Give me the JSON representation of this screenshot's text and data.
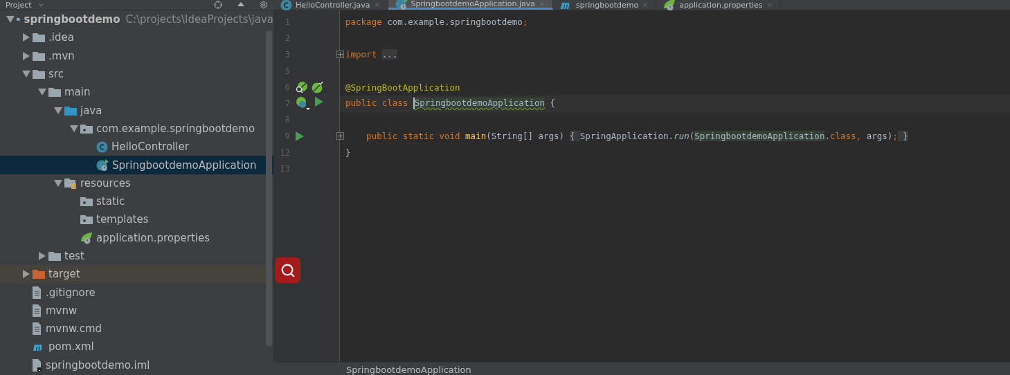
{
  "project_panel": {
    "title": "Project",
    "tree": [
      {
        "label": "springbootdemo",
        "path": "C:\\projects\\IdeaProjects\\java",
        "kind": "module",
        "expanded": true,
        "selected": false,
        "children": [
          {
            "label": ".idea",
            "kind": "folder",
            "expanded": false,
            "selected": false
          },
          {
            "label": ".mvn",
            "kind": "folder",
            "expanded": false,
            "selected": false
          },
          {
            "label": "src",
            "kind": "folder",
            "expanded": true,
            "selected": false,
            "children": [
              {
                "label": "main",
                "kind": "folder",
                "expanded": true,
                "selected": false,
                "children": [
                  {
                    "label": "java",
                    "kind": "source-folder",
                    "expanded": true,
                    "selected": false,
                    "children": [
                      {
                        "label": "com.example.springbootdemo",
                        "kind": "package",
                        "expanded": true,
                        "selected": false,
                        "children": [
                          {
                            "label": "HelloController",
                            "kind": "class",
                            "selected": false
                          },
                          {
                            "label": "SpringbootdemoApplication",
                            "kind": "spring-class",
                            "selected": true
                          }
                        ]
                      }
                    ]
                  },
                  {
                    "label": "resources",
                    "kind": "resources",
                    "expanded": true,
                    "selected": false,
                    "children": [
                      {
                        "label": "static",
                        "kind": "package",
                        "selected": false
                      },
                      {
                        "label": "templates",
                        "kind": "package",
                        "selected": false
                      },
                      {
                        "label": "application.properties",
                        "kind": "spring-properties",
                        "selected": false
                      }
                    ]
                  }
                ]
              },
              {
                "label": "test",
                "kind": "folder",
                "expanded": false,
                "selected": false
              }
            ]
          },
          {
            "label": "target",
            "kind": "excluded-folder",
            "expanded": false,
            "selected": false
          },
          {
            "label": ".gitignore",
            "kind": "file",
            "selected": false
          },
          {
            "label": "mvnw",
            "kind": "file",
            "selected": false
          },
          {
            "label": "mvnw.cmd",
            "kind": "file",
            "selected": false
          },
          {
            "label": "pom.xml",
            "kind": "maven",
            "selected": false
          },
          {
            "label": "springbootdemo.iml",
            "kind": "iml",
            "selected": false
          }
        ]
      }
    ]
  },
  "tabs": [
    {
      "label": "HelloController.java",
      "kind": "class",
      "selected": false
    },
    {
      "label": "SpringbootdemoApplication.java",
      "kind": "spring-class",
      "selected": true
    },
    {
      "label": "springbootdemo",
      "kind": "maven",
      "selected": false
    },
    {
      "label": "application.properties",
      "kind": "spring-properties",
      "selected": false
    }
  ],
  "editor": {
    "lines": [
      {
        "number": "1",
        "current": false,
        "fold": false,
        "tokens": [
          {
            "text": "package ",
            "kind": "keyword"
          },
          {
            "text": "com.example.springbootdemo",
            "kind": "plain"
          },
          {
            "text": ";",
            "kind": "keyword"
          }
        ]
      },
      {
        "number": "2",
        "current": false,
        "fold": false
      },
      {
        "number": "3",
        "current": false,
        "fold": true,
        "tokens": [
          {
            "text": "import ",
            "kind": "keyword"
          },
          {
            "text": "...",
            "kind": "folded"
          }
        ]
      },
      {
        "number": "5",
        "current": false,
        "fold": false
      },
      {
        "number": "6",
        "current": false,
        "fold": false,
        "gutter": [
          {
            "kind": "bean-search"
          },
          {
            "kind": "bean-check"
          }
        ],
        "tokens": [
          {
            "text": "@SpringBootApplication",
            "kind": "annotation"
          }
        ]
      },
      {
        "number": "7",
        "current": true,
        "fold": false,
        "gutter": [
          {
            "kind": "bean-class"
          },
          {
            "kind": "run"
          }
        ],
        "tokens": [
          {
            "text": "public class ",
            "kind": "keyword"
          },
          {
            "text": "SpringbootdemoApplication",
            "kind": "declaration"
          },
          {
            "text": " {",
            "kind": "plain"
          }
        ]
      },
      {
        "number": "8",
        "current": false,
        "fold": false
      },
      {
        "number": "9",
        "current": false,
        "fold": true,
        "gutter": [
          {
            "kind": "run"
          }
        ],
        "tokens": [
          {
            "text": "    public static void ",
            "kind": "keyword"
          },
          {
            "text": "main",
            "kind": "method"
          },
          {
            "text": "(String[] args) ",
            "kind": "plain"
          },
          {
            "text": "{ ",
            "kind": "folded"
          },
          {
            "text": "SpringApplication.",
            "kind": "plain"
          },
          {
            "text": "run",
            "kind": "static-call"
          },
          {
            "text": "(",
            "kind": "plain"
          },
          {
            "text": "SpringbootdemoApplication",
            "kind": "reference"
          },
          {
            "text": ".",
            "kind": "plain"
          },
          {
            "text": "class, ",
            "kind": "keyword"
          },
          {
            "text": "args)",
            "kind": "plain"
          },
          {
            "text": ";",
            "kind": "keyword"
          },
          {
            "text": " }",
            "kind": "folded"
          }
        ]
      },
      {
        "number": "12",
        "current": false,
        "fold": false,
        "tokens": [
          {
            "text": "}",
            "kind": "plain"
          }
        ]
      },
      {
        "number": "13",
        "current": false,
        "fold": false
      }
    ]
  },
  "breadcrumb": "SpringbootdemoApplication"
}
